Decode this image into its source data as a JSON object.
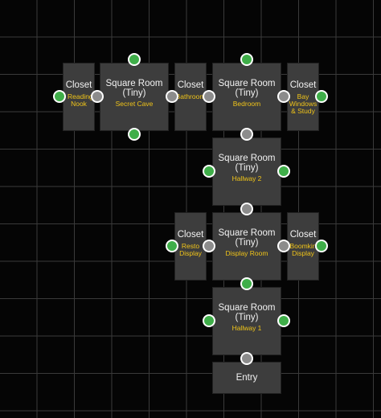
{
  "rooms": {
    "closet_reading_nook": {
      "type": "Closet",
      "label": "Reading Nook"
    },
    "secret_cave": {
      "type": "Square Room (Tiny)",
      "label": "Secret Cave"
    },
    "closet_bathroom": {
      "type": "Closet",
      "label": "Bathroom"
    },
    "bedroom": {
      "type": "Square Room (Tiny)",
      "label": "Bedroom"
    },
    "closet_bay_windows": {
      "type": "Closet",
      "label": "Bay Windows & Study"
    },
    "hallway_2": {
      "type": "Square Room (Tiny)",
      "label": "Hallway 2"
    },
    "closet_resto_display": {
      "type": "Closet",
      "label": "Resto Display"
    },
    "display_room": {
      "type": "Square Room (Tiny)",
      "label": "Display Room"
    },
    "closet_boomkin_display": {
      "type": "Closet",
      "label": "Boomkin Display"
    },
    "hallway_1": {
      "type": "Square Room (Tiny)",
      "label": "Hallway 1"
    },
    "entry": {
      "type": "Entry"
    }
  },
  "legend_colors": {
    "open_connector": "#3fae49",
    "linked_connector": "#8c8c8c",
    "room_label": "#f0c419"
  }
}
